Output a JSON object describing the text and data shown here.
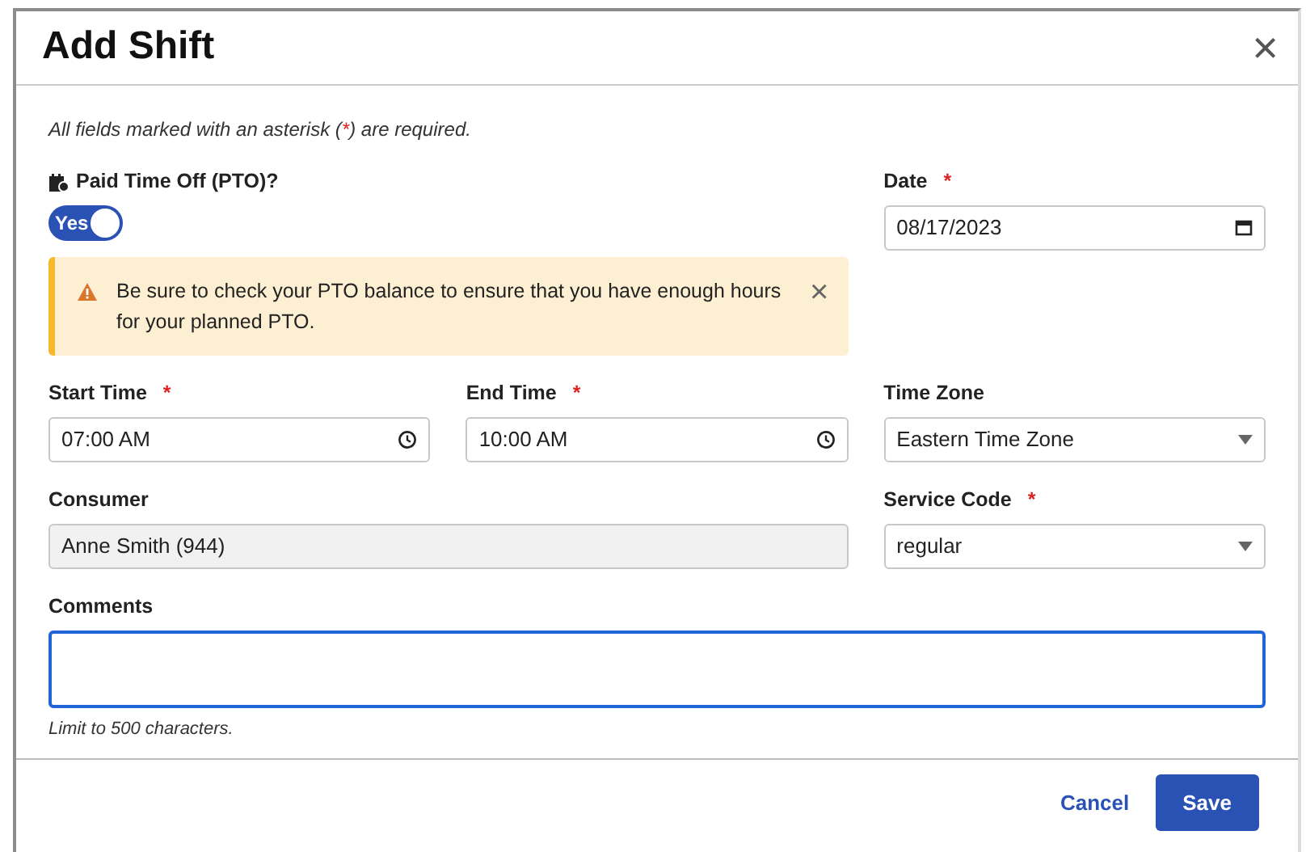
{
  "dialog": {
    "title": "Add Shift",
    "close": "×"
  },
  "note": [
    {
      "kind": "text",
      "text": "All fields marked with an asterisk ("
    },
    {
      "kind": "mark",
      "text": "*"
    },
    {
      "kind": "text",
      "text": ") are required."
    }
  ],
  "pto": {
    "label": "Paid Time Off (PTO)?",
    "on": true,
    "state_text": "Yes"
  },
  "alert": {
    "text": "Be sure to check your PTO balance to ensure that you have enough hours for your planned PTO.",
    "close": "×"
  },
  "date": {
    "kind": "date",
    "label": "Date",
    "required": true,
    "value": "08/17/2023"
  },
  "rows": [
    [
      {
        "kind": "time",
        "label": "Start Time",
        "required": true,
        "value": "07:00 AM"
      },
      {
        "kind": "time",
        "label": "End Time",
        "required": true,
        "value": "10:00 AM"
      },
      {
        "kind": "select",
        "label": "Time Zone",
        "required": false,
        "value": "Eastern Time Zone"
      }
    ],
    [
      {
        "kind": "readonly",
        "label": "Consumer",
        "required": false,
        "value": "Anne Smith (944)"
      },
      {
        "kind": "select",
        "label": "Service Code",
        "required": true,
        "value": "regular"
      }
    ],
    [
      {
        "kind": "textarea",
        "label": "Comments",
        "required": false,
        "focused": true,
        "help": "Limit to 500 characters."
      }
    ]
  ],
  "buttons": [
    {
      "kind": "link",
      "label": "Cancel"
    },
    {
      "kind": "primary",
      "label": "Save"
    }
  ]
}
